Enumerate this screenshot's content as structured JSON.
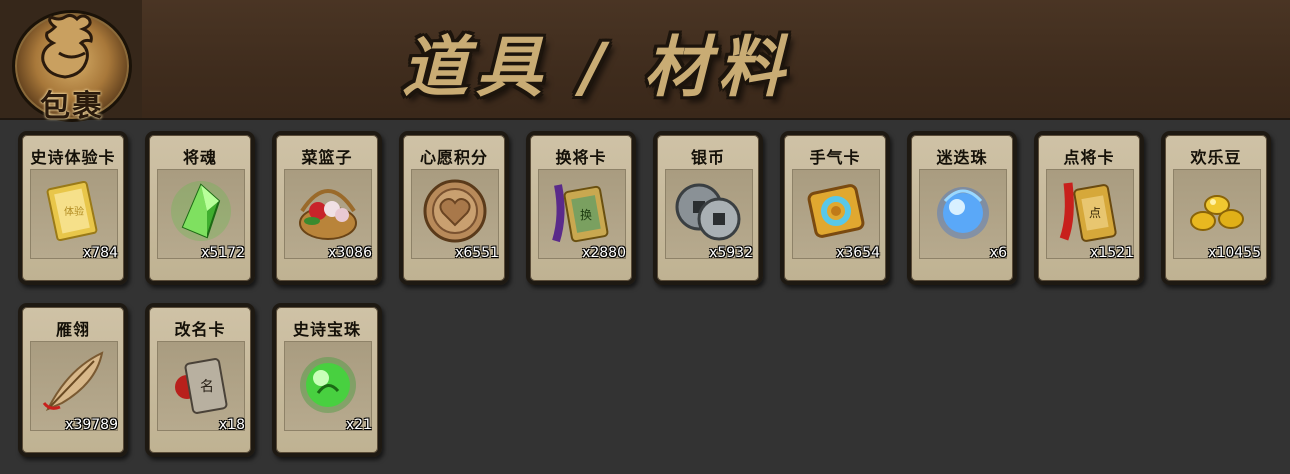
{
  "header": {
    "bag_label": "包裹",
    "title": "道具 / 材料"
  },
  "items": [
    {
      "name": "史诗体验卡",
      "count": "x784",
      "icon": "gold-card-icon"
    },
    {
      "name": "将魂",
      "count": "x5172",
      "icon": "green-crystal-icon"
    },
    {
      "name": "菜篮子",
      "count": "x3086",
      "icon": "flower-basket-icon"
    },
    {
      "name": "心愿积分",
      "count": "x6551",
      "icon": "heart-coin-icon"
    },
    {
      "name": "换将卡",
      "count": "x2880",
      "icon": "exchange-token-icon"
    },
    {
      "name": "银币",
      "count": "x5932",
      "icon": "silver-coins-icon"
    },
    {
      "name": "手气卡",
      "count": "x3654",
      "icon": "luck-card-icon"
    },
    {
      "name": "迷迭珠",
      "count": "x6",
      "icon": "blue-orb-icon"
    },
    {
      "name": "点将卡",
      "count": "x1521",
      "icon": "general-token-icon"
    },
    {
      "name": "欢乐豆",
      "count": "x10455",
      "icon": "gold-beans-icon"
    },
    {
      "name": "雁翎",
      "count": "x39789",
      "icon": "feather-icon"
    },
    {
      "name": "改名卡",
      "count": "x18",
      "icon": "rename-token-icon"
    },
    {
      "name": "史诗宝珠",
      "count": "x21",
      "icon": "green-orb-icon"
    }
  ]
}
